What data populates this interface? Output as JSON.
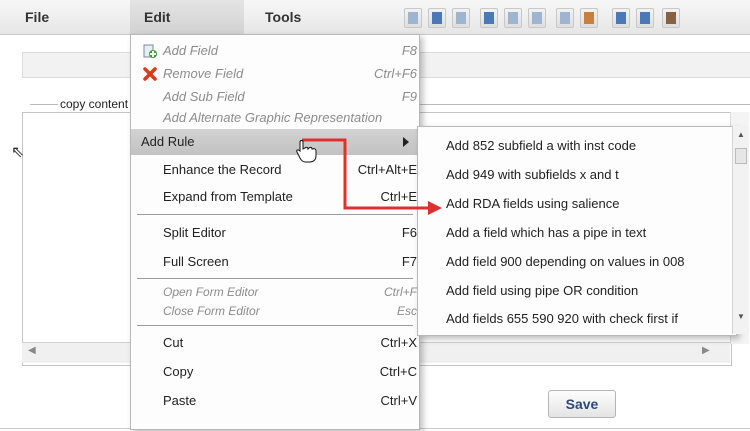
{
  "menubar": {
    "file_label": "File",
    "edit_label": "Edit",
    "tools_label": "Tools"
  },
  "toolbar_icons": [
    "new-record-icon",
    "save-icon",
    "cart-icon",
    "export-icon",
    "clipboard-icon",
    "copy-icon",
    "clipboard-paste-icon",
    "briefcase-icon",
    "expand-icon",
    "fullscreen-icon",
    "delete-icon"
  ],
  "editor": {
    "copy_content_label": "copy content",
    "save_label": "Save"
  },
  "edit_menu": {
    "add_field": {
      "label": "Add Field",
      "shortcut": "F8"
    },
    "remove_field": {
      "label": "Remove Field",
      "shortcut": "Ctrl+F6"
    },
    "add_sub_field": {
      "label": "Add Sub Field",
      "shortcut": "F9"
    },
    "add_alternate": {
      "label": "Add Alternate Graphic Representation"
    },
    "add_rule": {
      "label": "Add Rule"
    },
    "enhance_record": {
      "label": "Enhance the Record",
      "shortcut": "Ctrl+Alt+E"
    },
    "expand_template": {
      "label": "Expand from Template",
      "shortcut": "Ctrl+E"
    },
    "split_editor": {
      "label": "Split Editor",
      "shortcut": "F6"
    },
    "full_screen": {
      "label": "Full Screen",
      "shortcut": "F7"
    },
    "open_form_editor": {
      "label": "Open Form Editor",
      "shortcut": "Ctrl+F"
    },
    "close_form_editor": {
      "label": "Close Form Editor",
      "shortcut": "Esc"
    },
    "cut": {
      "label": "Cut",
      "shortcut": "Ctrl+X"
    },
    "copy": {
      "label": "Copy",
      "shortcut": "Ctrl+C"
    },
    "paste": {
      "label": "Paste",
      "shortcut": "Ctrl+V"
    }
  },
  "add_rule_submenu": [
    "Add 852 subfield a with inst code",
    "Add 949 with subfields x and t",
    "Add RDA fields using salience",
    "Add a field which has a pipe in text",
    "Add field 900 depending on values in 008",
    "Add field using pipe OR condition",
    "Add fields 655 590 920 with check first if"
  ],
  "colors": {
    "annotation_arrow": "#e0302e",
    "highlight": "#c8c8c8"
  }
}
